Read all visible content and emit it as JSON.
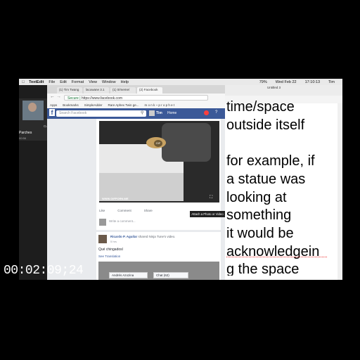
{
  "menubar": {
    "app": "TextEdit",
    "items": [
      "File",
      "Edit",
      "Format",
      "View",
      "Window",
      "Help"
    ],
    "right": [
      "79%",
      "Wed Feb 22",
      "17:10:13",
      "Tim"
    ]
  },
  "call": {
    "label": "Current Call",
    "name": "Parches",
    "duration": "00:56"
  },
  "browser": {
    "tabs": [
      "(1) Tim Twang",
      "lacowane 3.1",
      "(1) 0/meme/",
      "(2) Facebook"
    ],
    "secure_label": "Secure",
    "url": "https://www.facebook.com",
    "bookmarks": [
      "Apps",
      "Bookmarks",
      "SimpleAdder",
      "Rare Aphex Twin ge...",
      "m o n k ~ p r o p h e t"
    ]
  },
  "facebook": {
    "search_placeholder": "Search Facebook",
    "user": "Tim",
    "home": "Home",
    "gif_badge": "GIF",
    "watermark": "WWW.GIFPORN.ME",
    "actions": [
      "Like",
      "Comment",
      "Share"
    ],
    "comment_placeholder": "Write a comment...",
    "tooltip": "Attach a Photo or Video",
    "post2": {
      "author": "Ricardo P. Aguilar",
      "shared": "shared Ninja Tune's video.",
      "time": "5 hrs",
      "text": "Qué chingadosl",
      "see_translation": "See Translation"
    },
    "contact_chat": "Andrés Azozina",
    "chat": "Chat (62)"
  },
  "textedit": {
    "title": "Untitled 3",
    "lines": [
      "time/space",
      "outside itself",
      "",
      "for example, if",
      "a statue was",
      "looking at",
      "something",
      "it would be",
      "acknowledgein",
      "g the space"
    ]
  },
  "timecode": "00:02:09;24"
}
